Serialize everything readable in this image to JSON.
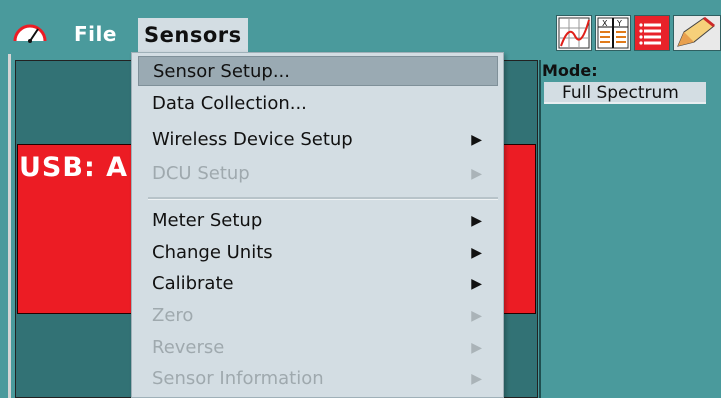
{
  "menubar": {
    "file_label": "File",
    "sensors_label": "Sensors",
    "app_icon": "gauge-icon",
    "toolbar_icons": [
      "graph-icon",
      "table-icon",
      "notebook-icon",
      "pencil-icon"
    ]
  },
  "meter": {
    "usb_label": "USB: A"
  },
  "mode_panel": {
    "label": "Mode:",
    "value": "Full Spectrum"
  },
  "sensors_menu": {
    "items": [
      {
        "label": "Sensor Setup...",
        "highlight": true
      },
      {
        "label": "Data Collection..."
      },
      {
        "label": "Wireless Device Setup",
        "submenu": true
      },
      {
        "label": "DCU Setup",
        "submenu": true,
        "disabled": true
      },
      {
        "label": "Meter Setup",
        "submenu": true
      },
      {
        "label": "Change Units",
        "submenu": true
      },
      {
        "label": "Calibrate",
        "submenu": true
      },
      {
        "label": "Zero",
        "submenu": true,
        "disabled": true
      },
      {
        "label": "Reverse",
        "submenu": true,
        "disabled": true
      },
      {
        "label": "Sensor Information",
        "submenu": true,
        "disabled": true
      }
    ],
    "submenu_arrow": "▶"
  },
  "colors": {
    "background": "#4a9a9c",
    "meter_panel": "#327275",
    "usb_box": "#ec1c24",
    "menu_bg": "#d3dde3",
    "menu_highlight": "#9aaab3"
  }
}
